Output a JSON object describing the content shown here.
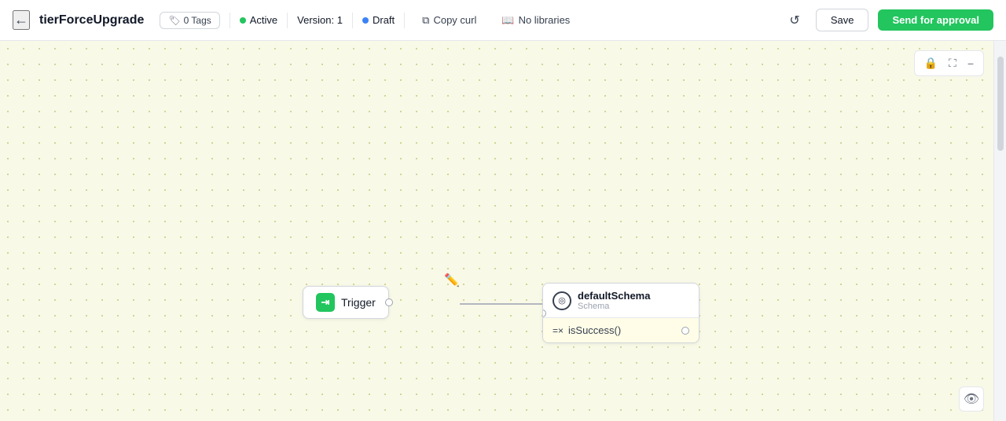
{
  "header": {
    "back_icon": "←",
    "title": "tierForceUpgrade",
    "tags_btn": "0 Tags",
    "active_label": "Active",
    "version_label": "Version: 1",
    "draft_label": "Draft",
    "copy_curl_label": "Copy curl",
    "no_libraries_label": "No libraries",
    "undo_icon": "↺",
    "save_label": "Save",
    "send_label": "Send for approval"
  },
  "canvas": {
    "trigger_label": "Trigger",
    "schema_title": "defaultSchema",
    "schema_subtitle": "Schema",
    "schema_row_text": "isSuccess()",
    "lock_icon": "🔒",
    "fullscreen_icon": "⛶",
    "minimize_icon": "−",
    "eye_icon": "👁"
  }
}
